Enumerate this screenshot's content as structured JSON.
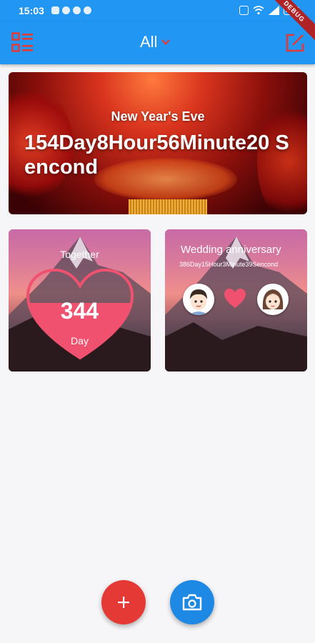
{
  "status_bar": {
    "time": "15:03",
    "icons_left": [
      "app-icon",
      "photos-icon",
      "chat-icon",
      "phone-icon"
    ],
    "icons_right": [
      "nfc-icon",
      "wifi-icon",
      "signal-icon",
      "battery-icon"
    ]
  },
  "debug_banner": "DEBUG",
  "app_bar": {
    "title": "All",
    "menu_icon": "list-menu-icon",
    "edit_icon": "edit-icon",
    "icon_color": "#e53935",
    "background": "#2196f3"
  },
  "banner_event": {
    "name": "New Year's Eve",
    "countdown": "154Day8Hour56Minute20 Sencond"
  },
  "together_card": {
    "label": "Together",
    "days": "344",
    "unit": "Day",
    "heart_color": "#f0516e"
  },
  "wedding_card": {
    "title": "Wedding anniversary",
    "countdown": "386Day15Hour3Minute39Sencond",
    "heart_color": "#f0516e"
  },
  "fab": {
    "add_icon": "plus-icon",
    "camera_icon": "camera-icon",
    "add_color": "#e53935",
    "camera_color": "#1e88e5"
  }
}
